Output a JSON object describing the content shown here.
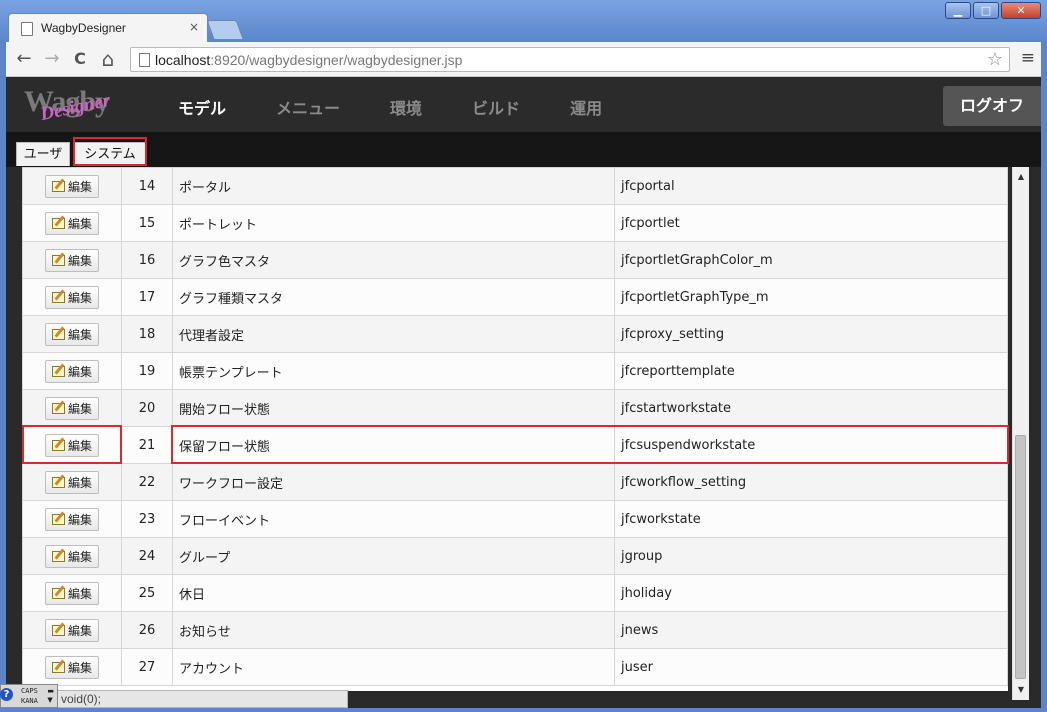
{
  "browser": {
    "tab_title": "WagbyDesigner",
    "tab_close": "×",
    "window_buttons": {
      "minimize": "▁",
      "maximize": "□",
      "close": "✕"
    },
    "nav": {
      "back": "←",
      "forward": "→",
      "reload": "C",
      "home": "⌂"
    },
    "url_host": "localhost",
    "url_rest": ":8920/wagbydesigner/wagbydesigner.jsp",
    "star": "☆",
    "menu": "≡"
  },
  "app": {
    "logo_w": "Wagby",
    "logo_d": "Designer",
    "nav": [
      "モデル",
      "メニュー",
      "環境",
      "ビルド",
      "運用"
    ],
    "logoff": "ログオフ"
  },
  "subtabs": {
    "user": "ユーザ",
    "system": "システム"
  },
  "table": {
    "edit_label": "編集",
    "rows": [
      {
        "no": "14",
        "name": "ポータル",
        "id": "jfcportal"
      },
      {
        "no": "15",
        "name": "ポートレット",
        "id": "jfcportlet"
      },
      {
        "no": "16",
        "name": "グラフ色マスタ",
        "id": "jfcportletGraphColor_m"
      },
      {
        "no": "17",
        "name": "グラフ種類マスタ",
        "id": "jfcportletGraphType_m"
      },
      {
        "no": "18",
        "name": "代理者設定",
        "id": "jfcproxy_setting"
      },
      {
        "no": "19",
        "name": "帳票テンプレート",
        "id": "jfcreporttemplate"
      },
      {
        "no": "20",
        "name": "開始フロー状態",
        "id": "jfcstartworkstate"
      },
      {
        "no": "21",
        "name": "保留フロー状態",
        "id": "jfcsuspendworkstate"
      },
      {
        "no": "22",
        "name": "ワークフロー設定",
        "id": "jfcworkflow_setting"
      },
      {
        "no": "23",
        "name": "フローイベント",
        "id": "jfcworkstate"
      },
      {
        "no": "24",
        "name": "グループ",
        "id": "jgroup"
      },
      {
        "no": "25",
        "name": "休日",
        "id": "jholiday"
      },
      {
        "no": "26",
        "name": "お知らせ",
        "id": "jnews"
      },
      {
        "no": "27",
        "name": "アカウント",
        "id": "juser"
      }
    ]
  },
  "statusbar": {
    "text": "void(0);"
  },
  "ime": {
    "help": "?",
    "caps": "CAPS",
    "kana": "KANA"
  },
  "colors": {
    "highlight": "#d9282e",
    "header_bg": "#2b2b2b"
  }
}
